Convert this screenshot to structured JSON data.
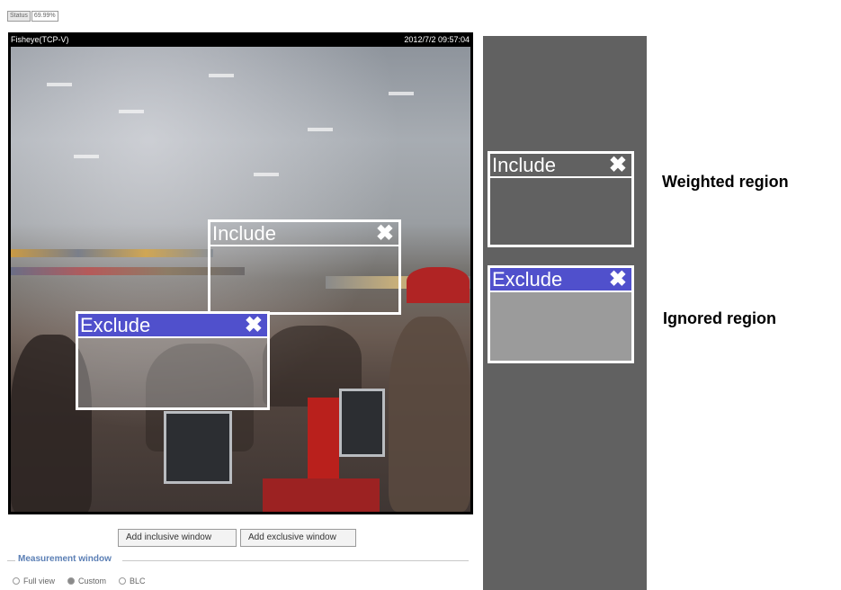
{
  "status_tabs": [
    "Status",
    "69.99%"
  ],
  "video": {
    "title": "Fisheye(TCP-V)",
    "timestamp": "2012/7/2 09:57:04"
  },
  "regions": {
    "include_label": "Include",
    "exclude_label": "Exclude",
    "close_glyph": "✖"
  },
  "legend": {
    "weighted": "Weighted region",
    "ignored": "Ignored region"
  },
  "buttons": {
    "add_inclusive": "Add inclusive window",
    "add_exclusive": "Add exclusive window"
  },
  "measurement": {
    "title": "Measurement window",
    "options": [
      "Full view",
      "Custom",
      "BLC"
    ],
    "selected": "Custom"
  },
  "colors": {
    "exclude_header": "#5050cc",
    "legend_panel": "#616161",
    "measurement_title": "#5b7fb5"
  }
}
